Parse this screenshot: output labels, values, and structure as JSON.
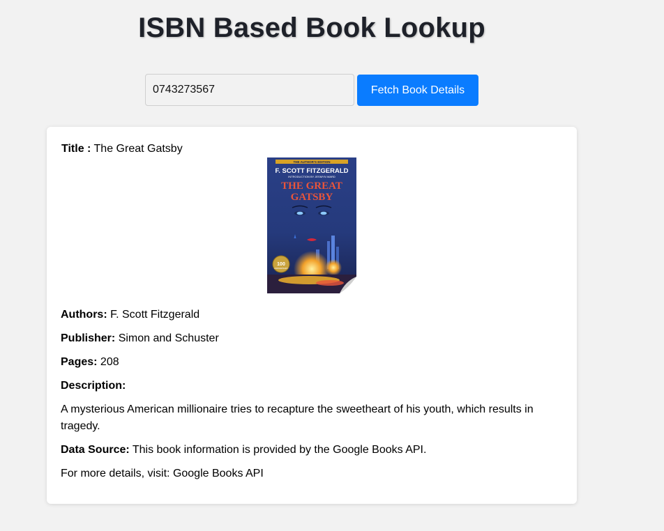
{
  "header": {
    "title": "ISBN Based Book Lookup"
  },
  "search": {
    "value": "0743273567",
    "button_label": "Fetch Book Details"
  },
  "book": {
    "title_label": "Title :",
    "title": "The Great Gatsby",
    "authors_label": "Authors:",
    "authors": "F. Scott Fitzgerald",
    "publisher_label": "Publisher:",
    "publisher": "Simon and Schuster",
    "pages_label": "Pages:",
    "pages": "208",
    "description_label": "Description:",
    "description": "A mysterious American millionaire tries to recapture the sweetheart of his youth, which results in tragedy.",
    "source_label": "Data Source:",
    "source_text": "This book information is provided by the Google Books API.",
    "more_text": "For more details, visit:",
    "more_link": "Google Books API",
    "cover": {
      "banner": "THE AUTHOR'S EDITION",
      "author": "F. SCOTT FITZGERALD",
      "intro": "INTRODUCTION BY JESMYN WARD",
      "title_line1": "THE GREAT",
      "title_line2": "GATSBY",
      "seal_number": "100",
      "seal_text": "ANNIVERSARY"
    }
  },
  "colors": {
    "accent": "#0a7cff",
    "background": "#f2f2f2",
    "card": "#ffffff"
  }
}
